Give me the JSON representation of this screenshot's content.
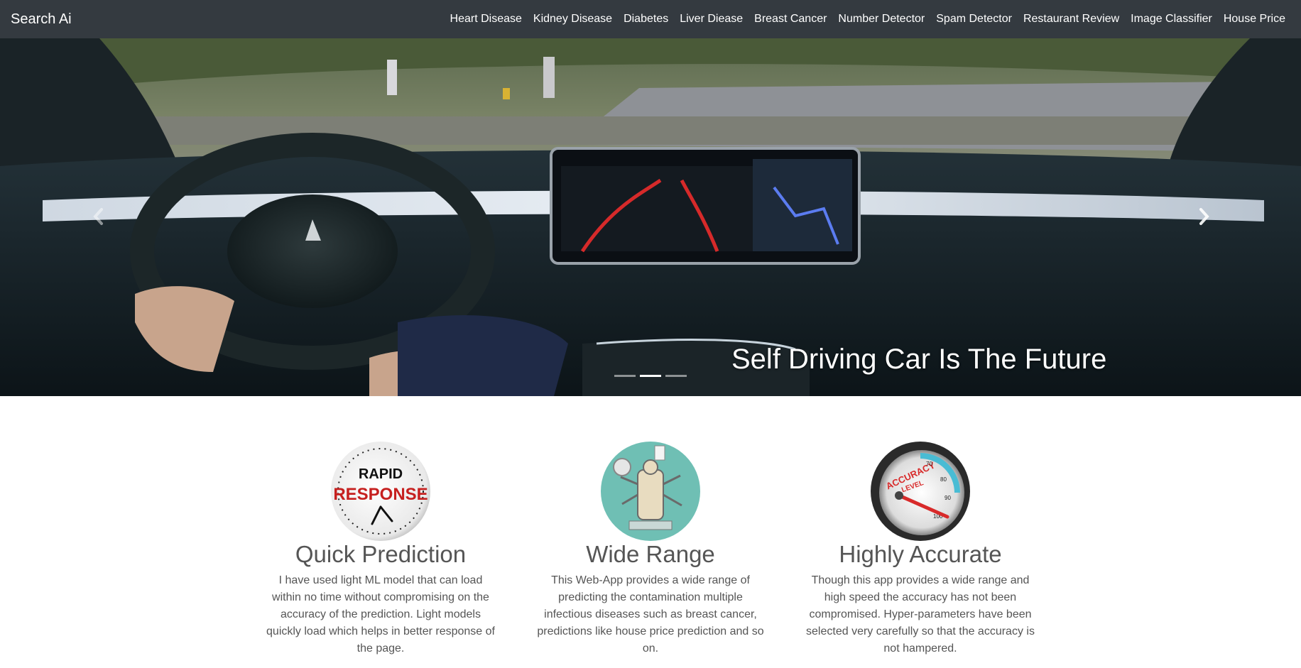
{
  "navbar": {
    "brand": "Search Ai",
    "links": [
      "Heart Disease",
      "Kidney Disease",
      "Diabetes",
      "Liver Diease",
      "Breast Cancer",
      "Number Detector",
      "Spam Detector",
      "Restaurant Review",
      "Image Classifier",
      "House Price"
    ]
  },
  "carousel": {
    "caption": "Self Driving Car Is The Future",
    "indicators": 3,
    "active_index": 1
  },
  "features": [
    {
      "title": "Quick Prediction",
      "text": "I have used light ML model that can load within no time without compromising on the accuracy of the prediction. Light models quickly load which helps in better response of the page.",
      "image_text": [
        "RAPID",
        "RESPONSE"
      ]
    },
    {
      "title": "Wide Range",
      "text": "This Web-App provides a wide range of predicting the contamination multiple infectious diseases such as breast cancer, predictions like house price prediction and so on."
    },
    {
      "title": "Highly Accurate",
      "text": "Though this app provides a wide range and high speed the accuracy has not been compromised. Hyper-parameters have been selected very carefully so that the accuracy is not hampered.",
      "image_text": [
        "ACCURACY",
        "LEVEL",
        "80",
        "90",
        "100",
        "70"
      ]
    }
  ],
  "colors": {
    "navbar": "#343a40",
    "text": "#555555"
  }
}
